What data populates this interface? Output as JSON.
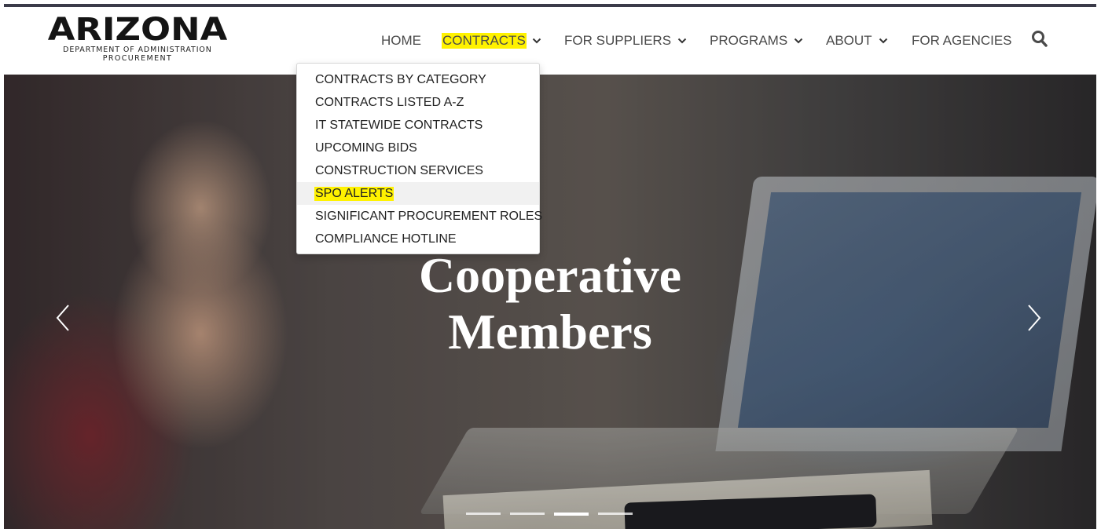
{
  "logo": {
    "wordmark": "ARIZONA",
    "line1": "DEPARTMENT OF ADMINISTRATION",
    "line2": "PROCUREMENT"
  },
  "nav": {
    "items": [
      {
        "label": "HOME",
        "has_dropdown": false
      },
      {
        "label": "CONTRACTS",
        "has_dropdown": true,
        "active": true
      },
      {
        "label": "FOR SUPPLIERS",
        "has_dropdown": true
      },
      {
        "label": "PROGRAMS",
        "has_dropdown": true
      },
      {
        "label": "ABOUT",
        "has_dropdown": true
      },
      {
        "label": "FOR AGENCIES",
        "has_dropdown": false
      }
    ],
    "search_icon": "search-icon"
  },
  "dropdown": {
    "items": [
      {
        "label": "CONTRACTS BY CATEGORY"
      },
      {
        "label": "CONTRACTS LISTED A-Z"
      },
      {
        "label": "IT STATEWIDE CONTRACTS"
      },
      {
        "label": "UPCOMING BIDS"
      },
      {
        "label": "CONSTRUCTION SERVICES"
      },
      {
        "label": "SPO ALERTS",
        "hovered": true,
        "highlighted": true
      },
      {
        "label": "SIGNIFICANT PROCUREMENT ROLES"
      },
      {
        "label": "COMPLIANCE HOTLINE"
      }
    ]
  },
  "hero": {
    "title_line1": "Cooperative",
    "title_line2": "Members",
    "slide_count": 4,
    "active_slide": 3
  },
  "colors": {
    "highlight": "#fff200",
    "top_bar": "#3b3b49",
    "nav_text": "#4a4a4a",
    "dropdown_text": "#222222"
  }
}
